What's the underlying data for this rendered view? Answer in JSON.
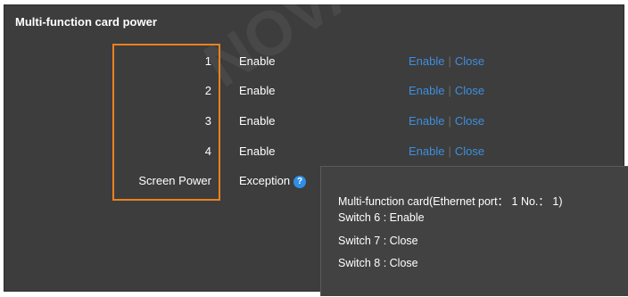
{
  "panel": {
    "title": "Multi-function card power"
  },
  "rows": [
    {
      "label": "1",
      "status": "Enable",
      "enable": "Enable",
      "sep": "|",
      "close": "Close"
    },
    {
      "label": "2",
      "status": "Enable",
      "enable": "Enable",
      "sep": "|",
      "close": "Close"
    },
    {
      "label": "3",
      "status": "Enable",
      "enable": "Enable",
      "sep": "|",
      "close": "Close"
    },
    {
      "label": "4",
      "status": "Enable",
      "enable": "Enable",
      "sep": "|",
      "close": "Close"
    }
  ],
  "screen_power": {
    "label": "Screen Power",
    "status": "Exception",
    "help_icon": "question-mark-icon",
    "help_glyph": "?"
  },
  "tooltip": {
    "lines": [
      "Multi-function card(Ethernet port： 1 No.： 1)",
      "Switch 6 : Enable",
      "Switch 7 : Close",
      "Switch 8 : Close"
    ]
  },
  "watermark": "NOVASTAR TECH",
  "colors": {
    "panel_bg": "#3d3d3d",
    "link": "#3d8fe0",
    "highlight": "#e8821e",
    "help": "#2f8ee5"
  }
}
